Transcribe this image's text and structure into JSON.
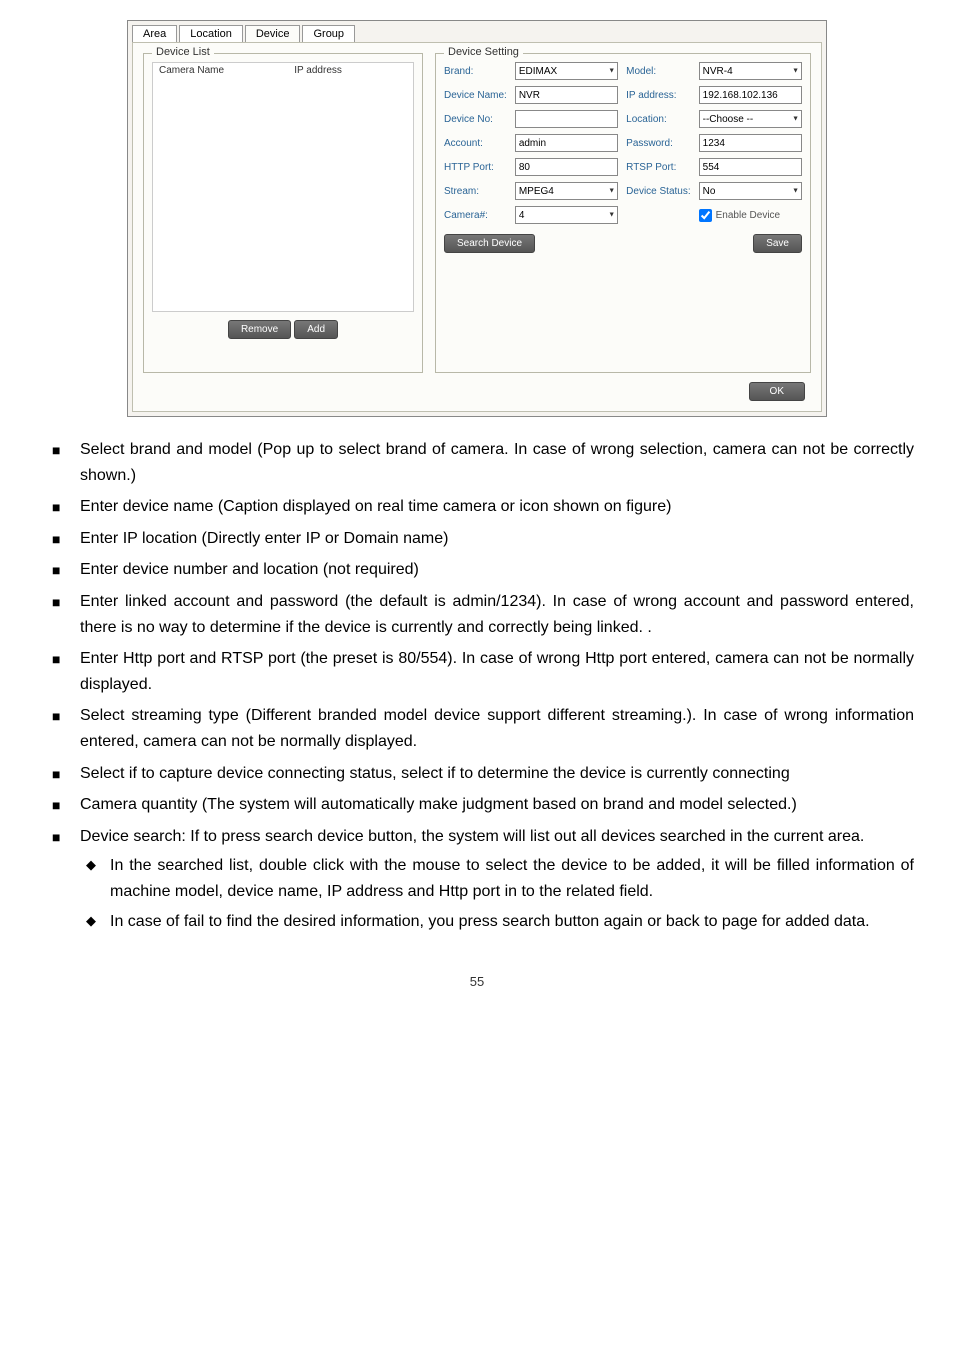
{
  "dialog": {
    "tabs": [
      "Area",
      "Location",
      "Device",
      "Group"
    ],
    "active_tab": 2,
    "device_list": {
      "legend": "Device List",
      "col1": "Camera Name",
      "col2": "IP address",
      "remove_btn": "Remove",
      "add_btn": "Add"
    },
    "device_setting": {
      "legend": "Device Setting",
      "brand_label": "Brand:",
      "brand_value": "EDIMAX",
      "model_label": "Model:",
      "model_value": "NVR-4",
      "devname_label": "Device Name:",
      "devname_value": "NVR",
      "ipaddr_label": "IP address:",
      "ipaddr_value": "192.168.102.136",
      "devno_label": "Device No:",
      "devno_value": "",
      "location_label": "Location:",
      "location_value": "--Choose --",
      "account_label": "Account:",
      "account_value": "admin",
      "password_label": "Password:",
      "password_value": "1234",
      "httpport_label": "HTTP Port:",
      "httpport_value": "80",
      "rtspport_label": "RTSP Port:",
      "rtspport_value": "554",
      "stream_label": "Stream:",
      "stream_value": "MPEG4",
      "devstatus_label": "Device Status:",
      "devstatus_value": "No",
      "camera_label": "Camera#:",
      "camera_value": "4",
      "enable_label": "Enable Device",
      "search_btn": "Search Device",
      "save_btn": "Save"
    },
    "ok_btn": "OK"
  },
  "bullets": [
    {
      "text": "Select brand and model (Pop up to select brand of camera. In case of wrong selection, camera can not be correctly shown.)"
    },
    {
      "text": "Enter device name (Caption displayed on real time camera or icon shown on figure)"
    },
    {
      "text": "Enter IP location (Directly enter IP or Domain name)"
    },
    {
      "text": "Enter device number and location (not required)"
    },
    {
      "text": "Enter linked account and password (the default is admin/1234). In case of wrong account and password entered, there is no way to determine if the device is currently and correctly being linked. ."
    },
    {
      "text": "Enter Http port and RTSP port (the preset is 80/554). In case of wrong Http port entered, camera can not be normally displayed."
    },
    {
      "text": "Select streaming type (Different branded model device support different streaming.). In case of wrong information entered, camera can not be normally displayed."
    },
    {
      "text": "Select if to capture device connecting status, select if to determine the device is currently connecting"
    },
    {
      "text": "Camera quantity (The system will automatically make judgment based on brand and model selected.)"
    },
    {
      "text": "Device search: If to press search device button, the system will list out all devices searched in the current area.",
      "subs": [
        "In the searched list, double click with the mouse to select the device to be added, it will be filled information of machine model, device name, IP address and Http port in to the related field.",
        "In case of fail to find the desired information, you press search button again or back to page for added data."
      ]
    }
  ],
  "page_number": "55"
}
